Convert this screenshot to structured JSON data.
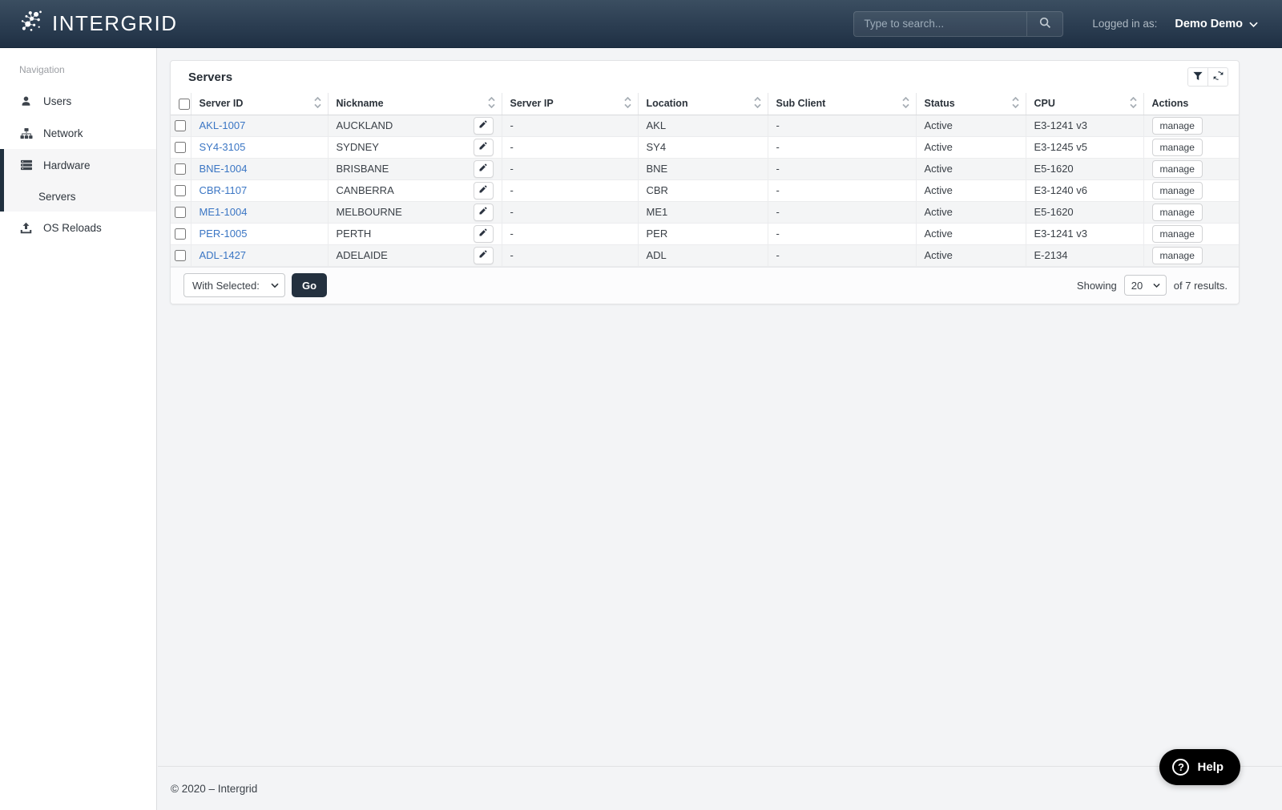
{
  "navbar": {
    "brand": "INTERGRID",
    "search": {
      "placeholder": "Type to search..."
    },
    "logged_in_label": "Logged in as:",
    "user_name": "Demo Demo"
  },
  "sidebar": {
    "section_label": "Navigation",
    "items": [
      {
        "label": "Users",
        "icon": "user-icon"
      },
      {
        "label": "Network",
        "icon": "sitemap-icon"
      },
      {
        "label": "Hardware",
        "icon": "server-icon",
        "active": true
      },
      {
        "label": "Servers",
        "sub_item_of": "Hardware"
      },
      {
        "label": "OS Reloads",
        "icon": "upload-icon"
      }
    ]
  },
  "panel": {
    "title": "Servers",
    "tools": [
      {
        "icon": "filter-icon"
      },
      {
        "icon": "refresh-icon"
      }
    ]
  },
  "table": {
    "columns": [
      "Server ID",
      "Nickname",
      "Server IP",
      "Location",
      "Sub Client",
      "Status",
      "CPU",
      "Actions"
    ],
    "rows": [
      {
        "server_id": "AKL-1007",
        "nickname": "AUCKLAND",
        "server_ip": "-",
        "location": "AKL",
        "sub_client": "-",
        "status": "Active",
        "cpu": "E3-1241 v3",
        "action": "manage"
      },
      {
        "server_id": "SY4-3105",
        "nickname": "SYDNEY",
        "server_ip": "-",
        "location": "SY4",
        "sub_client": "-",
        "status": "Active",
        "cpu": "E3-1245 v5",
        "action": "manage"
      },
      {
        "server_id": "BNE-1004",
        "nickname": "BRISBANE",
        "server_ip": "-",
        "location": "BNE",
        "sub_client": "-",
        "status": "Active",
        "cpu": "E5-1620",
        "action": "manage"
      },
      {
        "server_id": "CBR-1107",
        "nickname": "CANBERRA",
        "server_ip": "-",
        "location": "CBR",
        "sub_client": "-",
        "status": "Active",
        "cpu": "E3-1240 v6",
        "action": "manage"
      },
      {
        "server_id": "ME1-1004",
        "nickname": "MELBOURNE",
        "server_ip": "-",
        "location": "ME1",
        "sub_client": "-",
        "status": "Active",
        "cpu": "E5-1620",
        "action": "manage"
      },
      {
        "server_id": "PER-1005",
        "nickname": "PERTH",
        "server_ip": "-",
        "location": "PER",
        "sub_client": "-",
        "status": "Active",
        "cpu": "E3-1241 v3",
        "action": "manage"
      },
      {
        "server_id": "ADL-1427",
        "nickname": "ADELAIDE",
        "server_ip": "-",
        "location": "ADL",
        "sub_client": "-",
        "status": "Active",
        "cpu": "E-2134",
        "action": "manage"
      }
    ]
  },
  "table_footer": {
    "with_selected_label": "With Selected:",
    "go_label": "Go",
    "showing_label": "Showing",
    "page_size": "20",
    "results_label": "of 7 results."
  },
  "footer": {
    "copyright": "© 2020 – Intergrid",
    "help_label": "Help"
  },
  "colors": {
    "navbar_top": "#3b4e61",
    "navbar_bottom": "#1f3044",
    "accent_dark": "#24313f",
    "link_blue": "#3b76c4",
    "row_stripe": "#f4f5f6"
  }
}
